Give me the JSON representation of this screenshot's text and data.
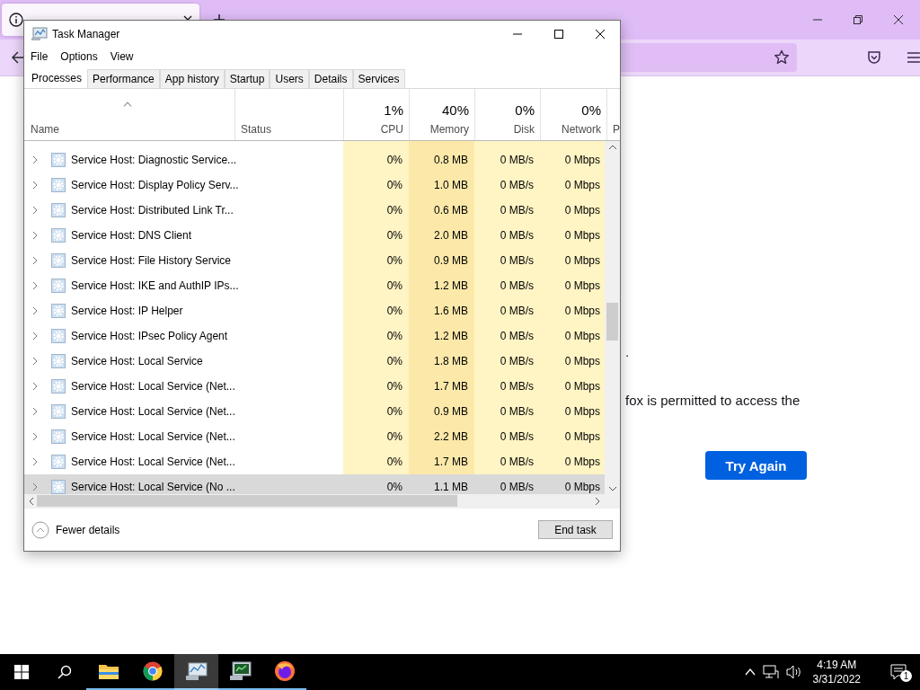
{
  "browser": {
    "content_fragments": [
      ".",
      "fox is permitted to access the"
    ],
    "button": "Try Again"
  },
  "task_manager": {
    "title": "Task Manager",
    "menu": [
      "File",
      "Options",
      "View"
    ],
    "tabs": [
      {
        "label": "Processes",
        "selected": true
      },
      {
        "label": "Performance",
        "selected": false
      },
      {
        "label": "App history",
        "selected": false
      },
      {
        "label": "Startup",
        "selected": false
      },
      {
        "label": "Users",
        "selected": false
      },
      {
        "label": "Details",
        "selected": false
      },
      {
        "label": "Services",
        "selected": false
      }
    ],
    "columns": [
      {
        "heading": "Name"
      },
      {
        "heading": "Status"
      },
      {
        "heading": "CPU",
        "percent": "1%"
      },
      {
        "heading": "Memory",
        "percent": "40%"
      },
      {
        "heading": "Disk",
        "percent": "0%"
      },
      {
        "heading": "Network",
        "percent": "0%"
      },
      {
        "heading": "P"
      }
    ],
    "rows": [
      {
        "name": "Service Host: Diagnostic Service...",
        "cpu": "0%",
        "memory": "0.8 MB",
        "disk": "0 MB/s",
        "network": "0 Mbps",
        "selected": false
      },
      {
        "name": "Service Host: Display Policy Serv...",
        "cpu": "0%",
        "memory": "1.0 MB",
        "disk": "0 MB/s",
        "network": "0 Mbps",
        "selected": false
      },
      {
        "name": "Service Host: Distributed Link Tr...",
        "cpu": "0%",
        "memory": "0.6 MB",
        "disk": "0 MB/s",
        "network": "0 Mbps",
        "selected": false
      },
      {
        "name": "Service Host: DNS Client",
        "cpu": "0%",
        "memory": "2.0 MB",
        "disk": "0 MB/s",
        "network": "0 Mbps",
        "selected": false
      },
      {
        "name": "Service Host: File History Service",
        "cpu": "0%",
        "memory": "0.9 MB",
        "disk": "0 MB/s",
        "network": "0 Mbps",
        "selected": false
      },
      {
        "name": "Service Host: IKE and AuthIP IPs...",
        "cpu": "0%",
        "memory": "1.2 MB",
        "disk": "0 MB/s",
        "network": "0 Mbps",
        "selected": false
      },
      {
        "name": "Service Host: IP Helper",
        "cpu": "0%",
        "memory": "1.6 MB",
        "disk": "0 MB/s",
        "network": "0 Mbps",
        "selected": false
      },
      {
        "name": "Service Host: IPsec Policy Agent",
        "cpu": "0%",
        "memory": "1.2 MB",
        "disk": "0 MB/s",
        "network": "0 Mbps",
        "selected": false
      },
      {
        "name": "Service Host: Local Service",
        "cpu": "0%",
        "memory": "1.8 MB",
        "disk": "0 MB/s",
        "network": "0 Mbps",
        "selected": false
      },
      {
        "name": "Service Host: Local Service (Net...",
        "cpu": "0%",
        "memory": "1.7 MB",
        "disk": "0 MB/s",
        "network": "0 Mbps",
        "selected": false
      },
      {
        "name": "Service Host: Local Service (Net...",
        "cpu": "0%",
        "memory": "0.9 MB",
        "disk": "0 MB/s",
        "network": "0 Mbps",
        "selected": false
      },
      {
        "name": "Service Host: Local Service (Net...",
        "cpu": "0%",
        "memory": "2.2 MB",
        "disk": "0 MB/s",
        "network": "0 Mbps",
        "selected": false
      },
      {
        "name": "Service Host: Local Service (Net...",
        "cpu": "0%",
        "memory": "1.7 MB",
        "disk": "0 MB/s",
        "network": "0 Mbps",
        "selected": false
      },
      {
        "name": "Service Host: Local Service (No ...",
        "cpu": "0%",
        "memory": "1.1 MB",
        "disk": "0 MB/s",
        "network": "0 Mbps",
        "selected": true
      }
    ],
    "footer": {
      "toggle": "Fewer details",
      "button": "End task"
    }
  },
  "taskbar": {
    "apps": [
      {
        "kind": "explorer",
        "active": false
      },
      {
        "kind": "chrome",
        "active": false
      },
      {
        "kind": "taskmgr",
        "active": true
      },
      {
        "kind": "monitor",
        "active": false
      },
      {
        "kind": "firefox",
        "active": false
      }
    ],
    "time": "4:19 AM",
    "date": "3/31/2022",
    "notifications": "1"
  }
}
